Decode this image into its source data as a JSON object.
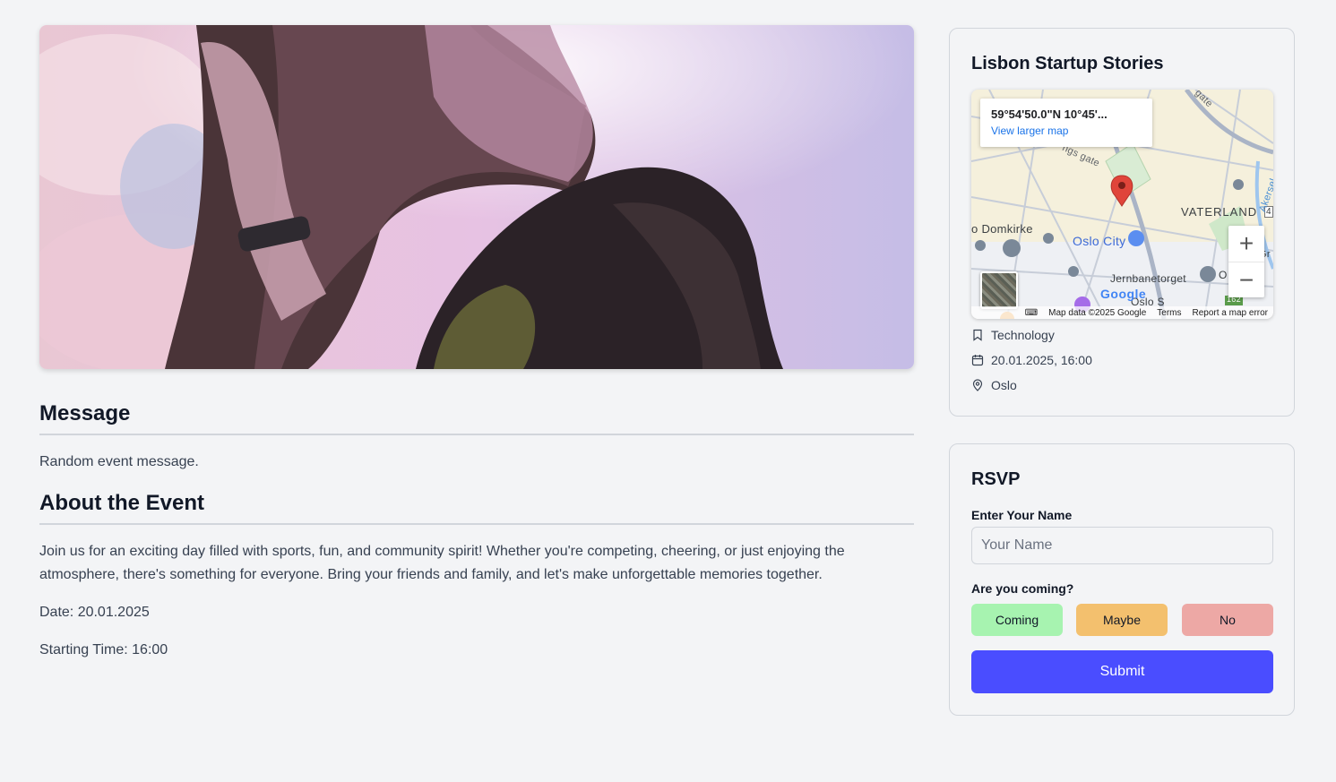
{
  "hero": {
    "image": "event-photo-woman-against-sky"
  },
  "message": {
    "heading": "Message",
    "text": "Random event message."
  },
  "about": {
    "heading": "About the Event",
    "description": "Join us for an exciting day filled with sports, fun, and community spirit! Whether you're competing, cheering, or just enjoying the atmosphere, there's something for everyone. Bring your friends and family, and let's make unforgettable memories together.",
    "date_line": "Date: 20.01.2025",
    "time_line": "Starting Time: 16:00"
  },
  "event_card": {
    "title": "Lisbon Startup Stories",
    "map": {
      "coords": "59°54'50.0\"N 10°45'...",
      "view_larger": "View larger map",
      "labels": {
        "domkirke": "o Domkirke",
        "oslo_city": "Oslo City",
        "vaterland": "VATERLAND",
        "jernbanetorget": "Jernbanetorget",
        "oslo_s": "Oslo S",
        "gate_top": "gate",
        "gate_mid": "ngs gate",
        "akerselva": "Akersel",
        "route_4": "4",
        "route_162": "162",
        "gr": "Gr",
        "o_partial": "O",
        "ss_partial": "ss"
      },
      "attribution": {
        "data": "Map data ©2025 Google",
        "terms": "Terms",
        "report": "Report a map error"
      },
      "logo": "Google"
    },
    "category": "Technology",
    "datetime": "20.01.2025, 16:00",
    "location": "Oslo"
  },
  "rsvp": {
    "title": "RSVP",
    "name_label": "Enter Your Name",
    "name_placeholder": "Your Name",
    "coming_label": "Are you coming?",
    "options": {
      "coming": "Coming",
      "maybe": "Maybe",
      "no": "No"
    },
    "submit": "Submit"
  },
  "colors": {
    "coming": "#a7f3b0",
    "maybe": "#f3c06e",
    "no": "#eda8a5",
    "submit": "#4a4dff"
  }
}
